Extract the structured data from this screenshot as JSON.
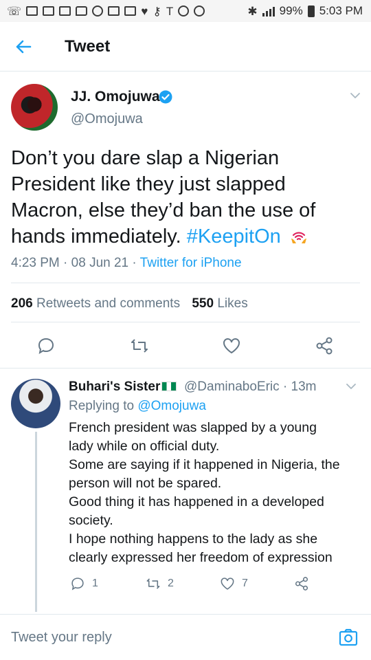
{
  "status_bar": {
    "battery": "99%",
    "time": "5:03 PM"
  },
  "header": {
    "title": "Tweet",
    "back_icon": "arrow-left-icon"
  },
  "tweet": {
    "author_name": "JJ. Omojuwa",
    "author_handle": "@Omojuwa",
    "text": "Don’t you dare slap a Nigerian President like they just slapped Macron, else they’d ban the use of hands immediately. ",
    "hashtag": "#KeepitOn",
    "time": "4:23 PM",
    "date": "08 Jun 21",
    "source": "Twitter for iPhone",
    "retweets_count": "206",
    "retweets_label": "Retweets and comments",
    "likes_count": "550",
    "likes_label": "Likes"
  },
  "reply": {
    "author_name": "Buhari's Sister",
    "author_handle": "@DaminaboEric",
    "age": "13m",
    "replying_prefix": "Replying to",
    "replying_to": "@Omojuwa",
    "lines": [
      "French president was slapped by a young",
      "lady while on official duty.",
      "Some are saying if it happened in Nigeria, the",
      "person will not be spared.",
      "Good thing it has happened in a developed",
      "society.",
      "I hope nothing happens to the lady as she",
      "clearly expressed her freedom of expression"
    ],
    "reply_count": "1",
    "retweet_count": "2",
    "like_count": "7"
  },
  "composer": {
    "placeholder": "Tweet your reply"
  },
  "colors": {
    "accent": "#1da1f2",
    "secondary_text": "#657786",
    "divider": "#e1e8ed"
  }
}
